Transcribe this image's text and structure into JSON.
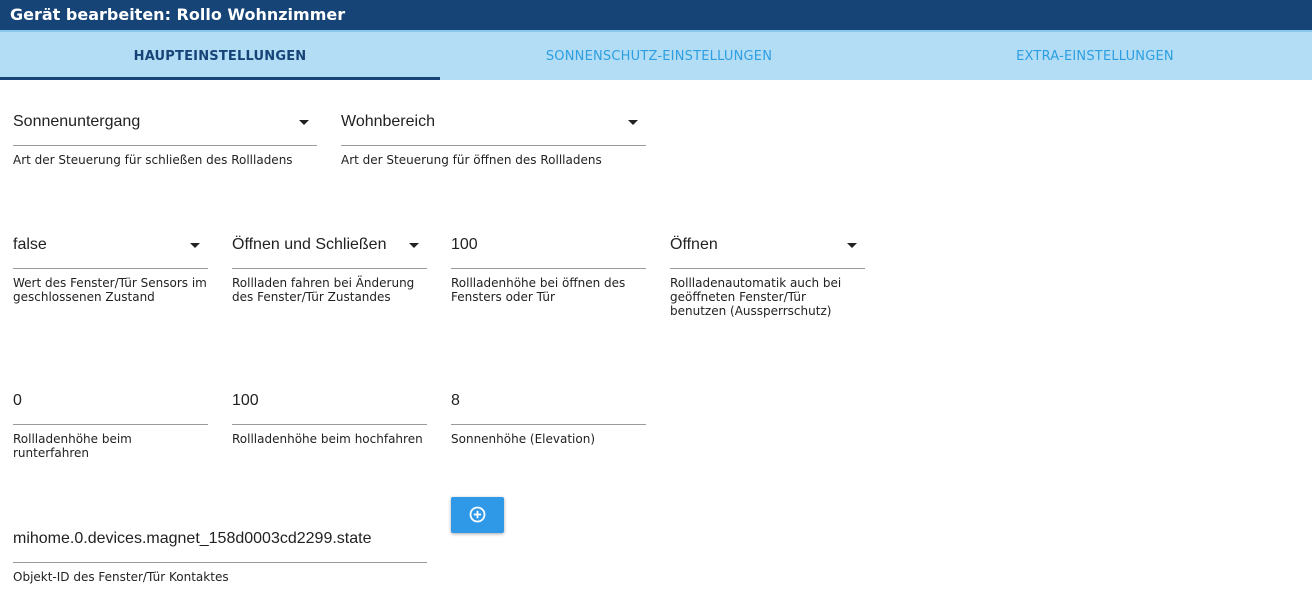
{
  "window": {
    "title": "Gerät bearbeiten: Rollo Wohnzimmer"
  },
  "tabs": [
    {
      "label": "HAUPTEINSTELLUNGEN",
      "active": true
    },
    {
      "label": "SONNENSCHUTZ-EINSTELLUNGEN",
      "active": false
    },
    {
      "label": "EXTRA-EINSTELLUNGEN",
      "active": false
    }
  ],
  "colors": {
    "titlebar": "#164477",
    "tabbar": "#b3dcf5",
    "tab_inactive_text": "#2c9fe1",
    "tab_active_text": "#164477",
    "button": "#2f99e8"
  },
  "fields": {
    "close_type": {
      "value": "Sonnenuntergang",
      "helper": "Art der Steuerung für schließen des Rollladens"
    },
    "open_type": {
      "value": "Wohnbereich",
      "helper": "Art der Steuerung für öffnen des Rollladens"
    },
    "sensor_closed_value": {
      "value": "false",
      "helper": "Wert des Fenster/Tür Sensors im geschlossenen Zustand"
    },
    "window_change_action": {
      "value": "Öffnen und Schließen",
      "helper": "Rollladen fahren bei Änderung des Fenster/Tür Zustandes"
    },
    "window_open_height": {
      "value": "100",
      "helper": "Rollladenhöhe bei öffnen des Fensters oder Tür"
    },
    "lockout_protection": {
      "value": "Öffnen",
      "helper": "Rollladenautomatik auch bei geöffneten Fenster/Tür benutzen (Aussperrschutz)"
    },
    "down_height": {
      "value": "0",
      "helper": "Rollladenhöhe beim runterfahren"
    },
    "up_height": {
      "value": "100",
      "helper": "Rollladenhöhe beim hochfahren"
    },
    "elevation": {
      "value": "8",
      "helper": "Sonnenhöhe (Elevation)"
    },
    "contact_object_id": {
      "value": "mihome.0.devices.magnet_158d0003cd2299.state",
      "helper": "Objekt-ID des Fenster/Tür Kontaktes"
    }
  },
  "add_button": {
    "icon": "plus-circle-icon"
  }
}
